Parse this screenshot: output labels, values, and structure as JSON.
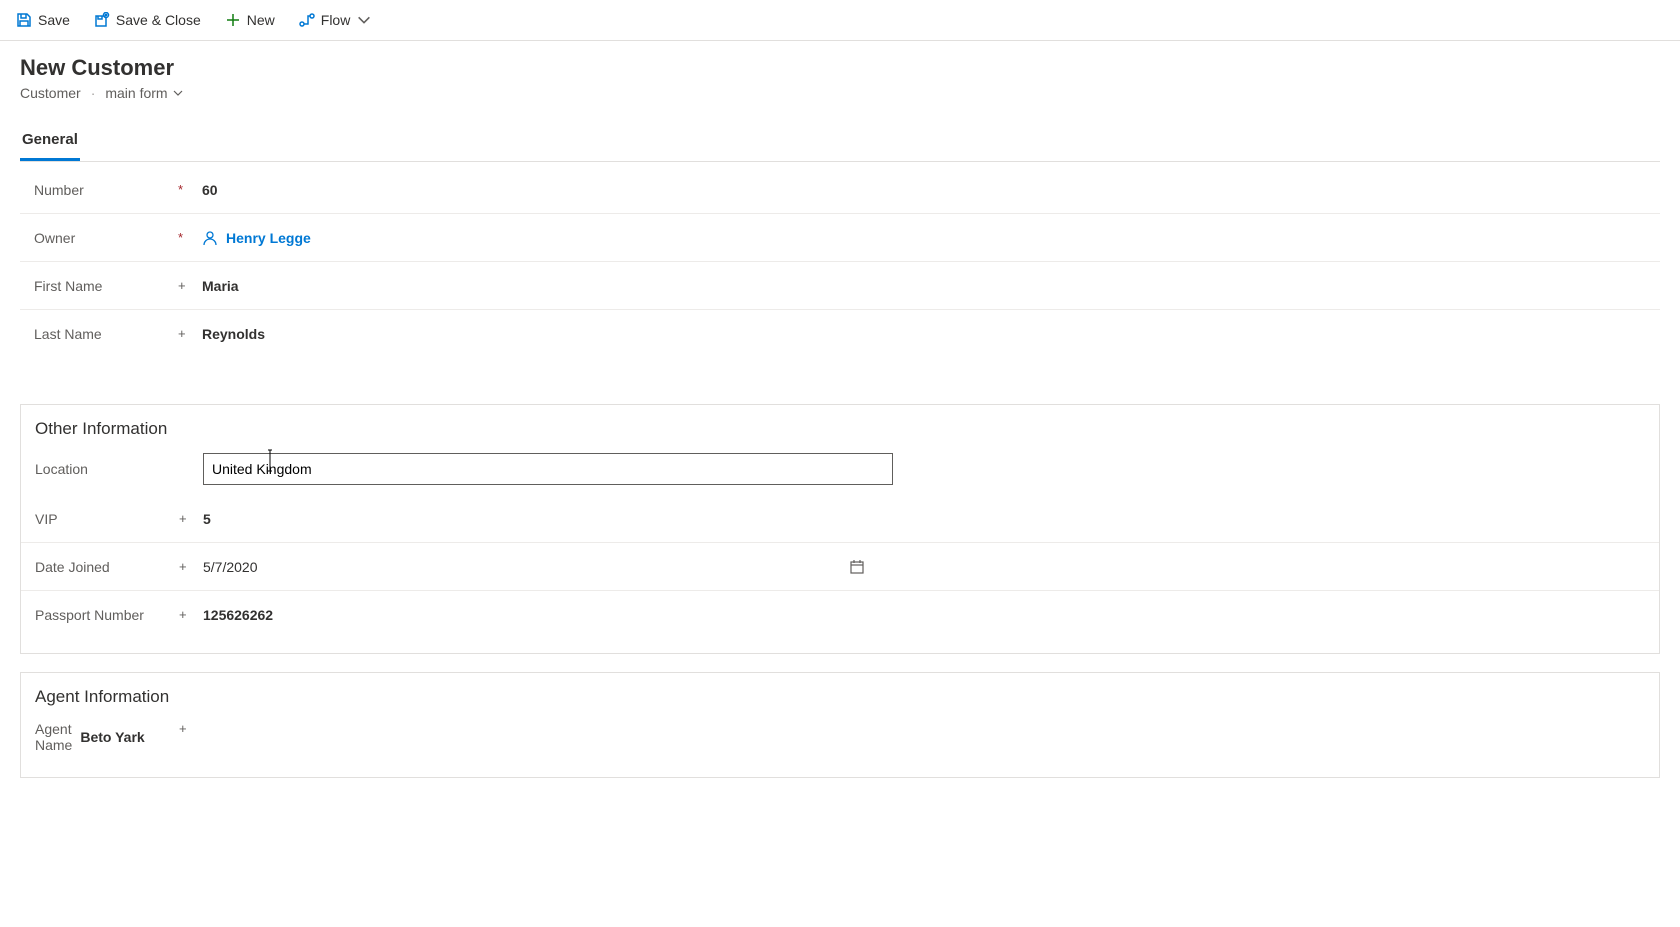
{
  "toolbar": {
    "save_label": "Save",
    "save_close_label": "Save & Close",
    "new_label": "New",
    "flow_label": "Flow"
  },
  "header": {
    "title": "New Customer",
    "entity": "Customer",
    "form_name": "main form"
  },
  "tabs": {
    "general": "General"
  },
  "fields": {
    "number_label": "Number",
    "number_value": "60",
    "owner_label": "Owner",
    "owner_value": "Henry Legge",
    "first_name_label": "First Name",
    "first_name_value": "Maria",
    "last_name_label": "Last Name",
    "last_name_value": "Reynolds"
  },
  "section_other": {
    "title": "Other Information",
    "location_label": "Location",
    "location_value": "United Kingdom",
    "vip_label": "VIP",
    "vip_value": "5",
    "date_joined_label": "Date Joined",
    "date_joined_value": "5/7/2020",
    "passport_label": "Passport Number",
    "passport_value": "125626262"
  },
  "section_agent": {
    "title": "Agent Information",
    "agent_name_label": "Agent Name",
    "agent_name_value": "Beto Yark"
  }
}
